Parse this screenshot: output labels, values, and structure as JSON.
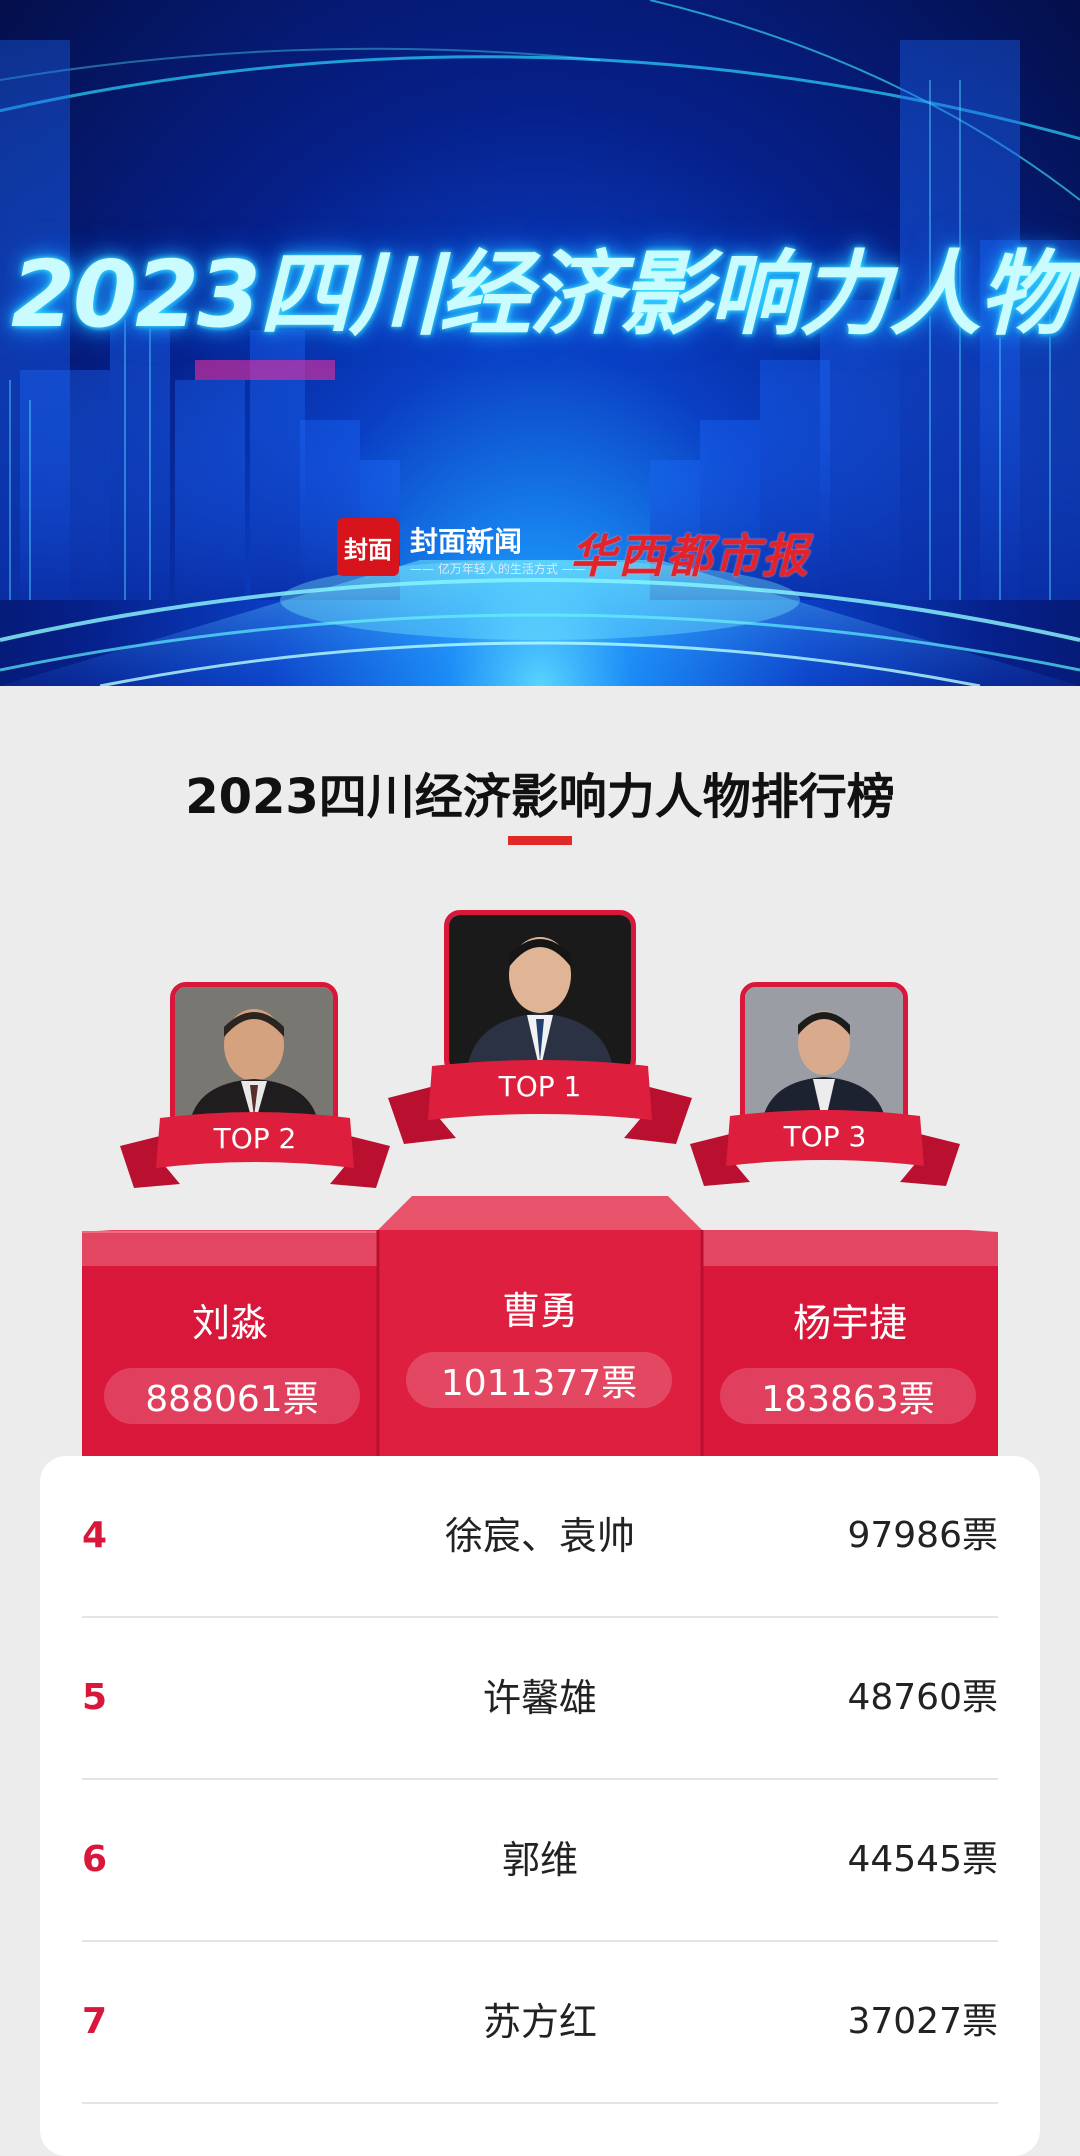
{
  "banner": {
    "title": "2023四川经济影响力人物",
    "logo_mark": "封面",
    "logo_name": "封面新闻",
    "logo_slogan": "—— 亿万年轻人的生活方式 ——",
    "paper_name": "华西都市报"
  },
  "ranking": {
    "title": "2023四川经济影响力人物排行榜",
    "accent_color": "#d9173a",
    "top3": [
      {
        "rank_label": "TOP 1",
        "name": "曹勇",
        "votes": "1011377票"
      },
      {
        "rank_label": "TOP 2",
        "name": "刘淼",
        "votes": "888061票"
      },
      {
        "rank_label": "TOP 3",
        "name": "杨宇捷",
        "votes": "183863票"
      }
    ],
    "list": [
      {
        "rank": "4",
        "name": "徐宸、袁帅",
        "votes": "97986票"
      },
      {
        "rank": "5",
        "name": "许馨雄",
        "votes": "48760票"
      },
      {
        "rank": "6",
        "name": "郭维",
        "votes": "44545票"
      },
      {
        "rank": "7",
        "name": "苏方红",
        "votes": "37027票"
      }
    ]
  }
}
